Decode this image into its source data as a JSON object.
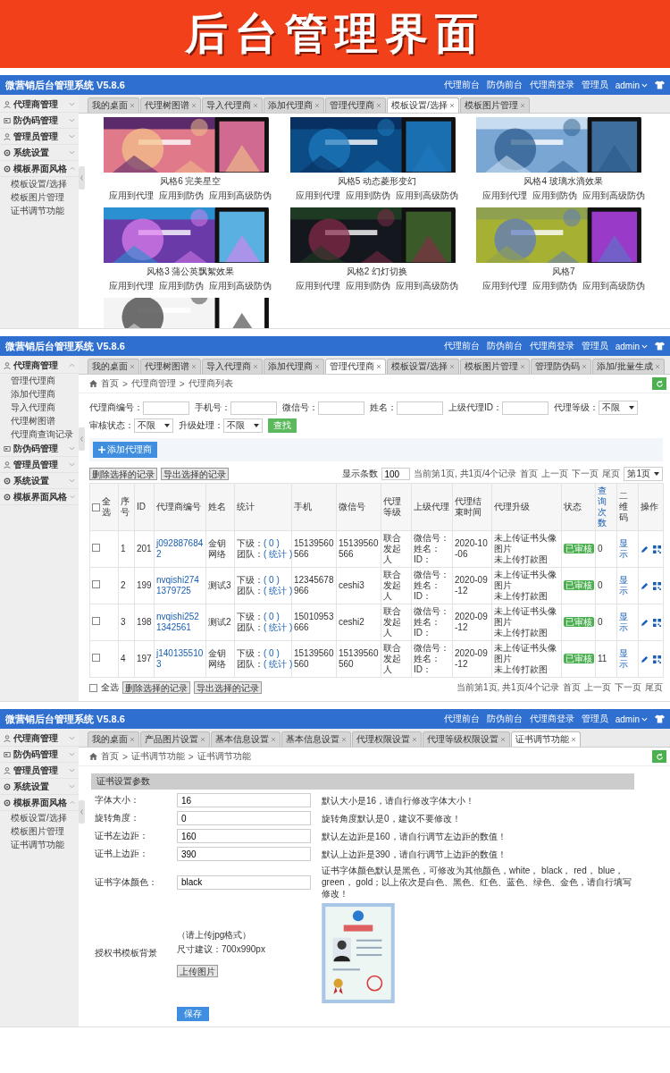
{
  "banner": {
    "title": "后台管理界面"
  },
  "screens": [
    {
      "kind": "templates",
      "topbar": {
        "title": "微营销后台管理系统 V5.8.6",
        "links": [
          "代理前台",
          "防伪前台",
          "代理商登录"
        ],
        "role": "管理员",
        "user": "admin"
      },
      "sidebar": [
        {
          "label": "代理商管理",
          "expanded": false
        },
        {
          "label": "防伪码管理",
          "expanded": false
        },
        {
          "label": "管理员管理",
          "expanded": false
        },
        {
          "label": "系统设置",
          "expanded": false
        },
        {
          "label": "模板界面风格",
          "expanded": true,
          "children": [
            "模板设置/选择",
            "模板图片管理",
            "证书调节功能"
          ]
        }
      ],
      "tabs": [
        {
          "label": "我的桌面",
          "selected": false
        },
        {
          "label": "代理树图谱",
          "selected": false
        },
        {
          "label": "导入代理商",
          "selected": false
        },
        {
          "label": "添加代理商",
          "selected": false
        },
        {
          "label": "管理代理商",
          "selected": false
        },
        {
          "label": "模板设置/选择",
          "selected": true
        },
        {
          "label": "模板图片管理",
          "selected": false
        }
      ],
      "gallery": [
        {
          "caption": "风格6 完美星空",
          "links": [
            "应用到代理",
            "应用到防伪",
            "应用到高级防伪"
          ]
        },
        {
          "caption": "风格5 动态菱形变幻",
          "links": [
            "应用到代理",
            "应用到防伪",
            "应用到高级防伪"
          ]
        },
        {
          "caption": "风格4 玻璃水滴效果",
          "links": [
            "应用到代理",
            "应用到防伪",
            "应用到高级防伪"
          ]
        },
        {
          "caption": "风格3 蒲公英飘絮效果",
          "links": [
            "应用到代理",
            "应用到防伪",
            "应用到高级防伪"
          ]
        },
        {
          "caption": "风格2 幻灯切换",
          "links": [
            "应用到代理",
            "应用到防伪",
            "应用到高级防伪"
          ]
        },
        {
          "caption": "风格7",
          "links": [
            "应用到代理",
            "应用到防伪",
            "应用到高级防伪"
          ]
        },
        {
          "kind": "picture"
        }
      ]
    },
    {
      "kind": "agents",
      "topbar": {
        "title": "微营销后台管理系统 V5.8.6",
        "links": [
          "代理前台",
          "防伪前台",
          "代理商登录"
        ],
        "role": "管理员",
        "user": "admin"
      },
      "sidebar": [
        {
          "label": "代理商管理",
          "expanded": true,
          "children": [
            "管理代理商",
            "添加代理商",
            "导入代理商",
            "代理树图谱",
            "代理商查询记录"
          ]
        },
        {
          "label": "防伪码管理",
          "expanded": false
        },
        {
          "label": "管理员管理",
          "expanded": false
        },
        {
          "label": "系统设置",
          "expanded": false
        },
        {
          "label": "模板界面风格",
          "expanded": false
        }
      ],
      "tabs": [
        {
          "label": "我的桌面",
          "selected": false
        },
        {
          "label": "代理树图谱",
          "selected": false
        },
        {
          "label": "导入代理商",
          "selected": false
        },
        {
          "label": "添加代理商",
          "selected": false
        },
        {
          "label": "管理代理商",
          "selected": true
        },
        {
          "label": "模板设置/选择",
          "selected": false
        },
        {
          "label": "模板图片管理",
          "selected": false
        },
        {
          "label": "管理防伪码",
          "selected": false
        },
        {
          "label": "添加/批量生成",
          "selected": false
        }
      ],
      "breadcrumb": [
        {
          "kind": "link",
          "label": "首页"
        },
        {
          "kind": "separator",
          "label": ">"
        },
        {
          "kind": "link",
          "label": "代理商管理"
        },
        {
          "kind": "separator",
          "label": ">"
        },
        {
          "kind": "link",
          "label": "代理商列表"
        }
      ],
      "filters": [
        {
          "label": "代理商编号：",
          "kind": "input"
        },
        {
          "label": "手机号：",
          "kind": "input"
        },
        {
          "label": "微信号：",
          "kind": "input"
        },
        {
          "label": "姓名：",
          "kind": "input"
        },
        {
          "label": "上级代理ID：",
          "kind": "input"
        },
        {
          "label": "代理等级：",
          "kind": "select",
          "value": "不限"
        },
        {
          "label": "审核状态：",
          "kind": "select",
          "value": "不限"
        },
        {
          "label": "升级处理：",
          "kind": "select",
          "value": "不限"
        }
      ],
      "search_button": "查找",
      "add_button": "添加代理商",
      "toolbar": {
        "buttons": [
          "删除选择的记录",
          "导出选择的记录"
        ],
        "page_size_label": "显示条数",
        "page_size": "100",
        "summary": "当前第1页, 共1页/4个记录",
        "pager": [
          "首页",
          "上一页",
          "下一页",
          "尾页"
        ],
        "page_select": "第1页"
      },
      "table": {
        "columns": [
          {
            "label": "全选",
            "kind": "select",
            "checked": false
          },
          {
            "label": "序号",
            "kind": "plain"
          },
          {
            "label": "ID",
            "kind": "plain"
          },
          {
            "label": "代理商编号",
            "kind": "plain"
          },
          {
            "label": "姓名",
            "kind": "plain"
          },
          {
            "label": "统计",
            "kind": "plain"
          },
          {
            "label": "手机",
            "kind": "plain"
          },
          {
            "label": "微信号",
            "kind": "plain"
          },
          {
            "label": "代理等级",
            "kind": "plain"
          },
          {
            "label": "上级代理",
            "kind": "plain"
          },
          {
            "label": "代理结束时间",
            "kind": "plain"
          },
          {
            "label": "代理升级",
            "kind": "plain"
          },
          {
            "label": "状态",
            "kind": "plain"
          },
          {
            "label": "查询次数",
            "kind": "sort"
          },
          {
            "label": "二维码",
            "kind": "plain"
          },
          {
            "label": "操作",
            "kind": "plain"
          }
        ],
        "rows": [
          {
            "checked": false,
            "no": "1",
            "id": "201",
            "code": "j0928876842",
            "name": "金钥网络",
            "stats": [
              {
                "label": "下级：",
                "link": "( 0 )"
              },
              {
                "label": "团队：",
                "link": "( 统计 )"
              }
            ],
            "phone": "15139560566",
            "wechat": "15139560566",
            "level": "联合发起人",
            "upline": [
              "微信号：",
              "姓名：",
              "ID："
            ],
            "end_date": "2020-10-06",
            "upgrade": [
              "未上传证书头像图片",
              "未上传打款图"
            ],
            "status": "已审核",
            "queries": "0",
            "qr": "显示"
          },
          {
            "checked": false,
            "no": "2",
            "id": "199",
            "code": "nvqishi2741379725",
            "name": "测试3",
            "stats": [
              {
                "label": "下级：",
                "link": "( 0 )"
              },
              {
                "label": "团队：",
                "link": "( 统计 )"
              }
            ],
            "phone": "12345678966",
            "wechat": "ceshi3",
            "level": "联合发起人",
            "upline": [
              "微信号：",
              "姓名：",
              "ID："
            ],
            "end_date": "2020-09-12",
            "upgrade": [
              "未上传证书头像图片",
              "未上传打款图"
            ],
            "status": "已审核",
            "queries": "0",
            "qr": "显示"
          },
          {
            "checked": false,
            "no": "3",
            "id": "198",
            "code": "nvqishi2521342561",
            "name": "测试2",
            "stats": [
              {
                "label": "下级：",
                "link": "( 0 )"
              },
              {
                "label": "团队：",
                "link": "( 统计 )"
              }
            ],
            "phone": "15010953666",
            "wechat": "ceshi2",
            "level": "联合发起人",
            "upline": [
              "微信号：",
              "姓名：",
              "ID："
            ],
            "end_date": "2020-09-12",
            "upgrade": [
              "未上传证书头像图片",
              "未上传打款图"
            ],
            "status": "已审核",
            "queries": "0",
            "qr": "显示"
          },
          {
            "checked": false,
            "no": "4",
            "id": "197",
            "code": "j1401355103",
            "name": "金钥网络",
            "stats": [
              {
                "label": "下级：",
                "link": "( 0 )"
              },
              {
                "label": "团队：",
                "link": "( 统计 )"
              }
            ],
            "phone": "15139560560",
            "wechat": "15139560560",
            "level": "联合发起人",
            "upline": [
              "微信号：",
              "姓名：",
              "ID："
            ],
            "end_date": "2020-09-12",
            "upgrade": [
              "未上传证书头像图片",
              "未上传打款图"
            ],
            "status": "已审核",
            "queries": "11",
            "qr": "显示"
          }
        ]
      },
      "footer": {
        "select_all": {
          "label": "全选",
          "checked": false
        },
        "buttons": [
          "删除选择的记录",
          "导出选择的记录"
        ],
        "summary": "当前第1页, 共1页/4个记录",
        "pager": [
          "首页",
          "上一页",
          "下一页",
          "尾页"
        ]
      }
    },
    {
      "kind": "certificate",
      "topbar": {
        "title": "微营销后台管理系统 V5.8.6",
        "links": [
          "代理前台",
          "防伪前台",
          "代理商登录"
        ],
        "role": "管理员",
        "user": "admin"
      },
      "sidebar": [
        {
          "label": "代理商管理",
          "expanded": false
        },
        {
          "label": "防伪码管理",
          "expanded": false
        },
        {
          "label": "管理员管理",
          "expanded": false
        },
        {
          "label": "系统设置",
          "expanded": false
        },
        {
          "label": "模板界面风格",
          "expanded": true,
          "children": [
            "模板设置/选择",
            "模板图片管理",
            "证书调节功能"
          ]
        }
      ],
      "tabs": [
        {
          "label": "我的桌面",
          "selected": false
        },
        {
          "label": "产品图片设置",
          "selected": false
        },
        {
          "label": "基本信息设置",
          "selected": false
        },
        {
          "label": "基本信息设置",
          "selected": false
        },
        {
          "label": "代理权限设置",
          "selected": false
        },
        {
          "label": "代理等级权限设置",
          "selected": false
        },
        {
          "label": "证书调节功能",
          "selected": true
        }
      ],
      "breadcrumb": [
        {
          "kind": "link",
          "label": "首页"
        },
        {
          "kind": "separator",
          "label": ">"
        },
        {
          "kind": "link",
          "label": "证书调节功能"
        },
        {
          "kind": "separator",
          "label": ">"
        },
        {
          "kind": "link",
          "label": "证书调节功能"
        }
      ],
      "form": {
        "section": "证书设置参数",
        "rows": [
          {
            "label": "字体大小：",
            "value": "16",
            "hint": "默认大小是16，请自行修改字体大小！"
          },
          {
            "label": "旋转角度：",
            "value": "0",
            "hint": "旋转角度默认是0，建议不要修改！"
          },
          {
            "label": "证书左边距：",
            "value": "160",
            "hint": "默认左边距是160，请自行调节左边距的数值！"
          },
          {
            "label": "证书上边距：",
            "value": "390",
            "hint": "默认上边距是390，请自行调节上边距的数值！"
          },
          {
            "label": "证书字体颜色：",
            "value": "black",
            "hint": "证书字体颜色默认是黑色，可修改为其他颜色，white， black， red， blue， green， gold；以上依次是白色、黑色、红色、蓝色、绿色、金色，请自行填写修改！"
          }
        ],
        "upload": {
          "label": "授权书模板背景",
          "notes": [
            "（请上传jpg格式）",
            "尺寸建议：700x990px"
          ],
          "button": "上传图片"
        },
        "save": "保存"
      }
    }
  ]
}
